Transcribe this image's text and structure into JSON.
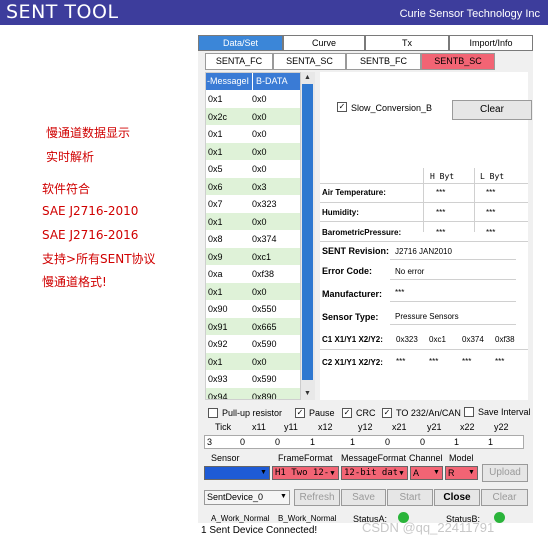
{
  "header": {
    "title": "SENT TOOL",
    "company": "Curie Sensor Technology Inc"
  },
  "notes": [
    "慢通道数据显示",
    "实时解析",
    "软件符合",
    "SAE J2716-2010",
    "SAE J2716-2016",
    "支持>所有SENT协议",
    "慢通道格式!"
  ],
  "tabs": [
    "Data/Set",
    "Curve",
    "Tx",
    "Import/Info"
  ],
  "subtabs": [
    "SENTA_FC",
    "SENTA_SC",
    "SENTB_FC",
    "SENTB_SC"
  ],
  "list": {
    "headers": [
      "-MessageI",
      "B-DATA"
    ],
    "rows": [
      [
        "0x1",
        "0x0"
      ],
      [
        "0x2c",
        "0x0"
      ],
      [
        "0x1",
        "0x0"
      ],
      [
        "0x1",
        "0x0"
      ],
      [
        "0x5",
        "0x0"
      ],
      [
        "0x6",
        "0x3"
      ],
      [
        "0x7",
        "0x323"
      ],
      [
        "0x1",
        "0x0"
      ],
      [
        "0x8",
        "0x374"
      ],
      [
        "0x9",
        "0xc1"
      ],
      [
        "0xa",
        "0xf38"
      ],
      [
        "0x1",
        "0x0"
      ],
      [
        "0x90",
        "0x550"
      ],
      [
        "0x91",
        "0x665"
      ],
      [
        "0x92",
        "0x590"
      ],
      [
        "0x1",
        "0x0"
      ],
      [
        "0x93",
        "0x590"
      ],
      [
        "0x94",
        "0x890"
      ]
    ]
  },
  "slow": {
    "checkbox_label": "Slow_Conversion_B",
    "checkbox_mark": "✓",
    "clear_label": "Clear",
    "col_hbyt": "H Byt",
    "col_lbyt": "L Byt",
    "measurements": [
      {
        "label": "Air Temperature:",
        "h": "***",
        "l": "***"
      },
      {
        "label": "Humidity:",
        "h": "***",
        "l": "***"
      },
      {
        "label": "BarometricPressure:",
        "h": "***",
        "l": "***"
      }
    ],
    "sent_revision_label": "SENT Revision:",
    "sent_revision_value": "J2716 JAN2010",
    "error_code_label": "Error Code:",
    "error_code_value": "No error",
    "manufacturer_label": "Manufacturer:",
    "manufacturer_value": "***",
    "sensor_type_label": "Sensor Type:",
    "sensor_type_value": "Pressure Sensors",
    "c1_label": "C1 X1/Y1 X2/Y2:",
    "c1_values": [
      "0x323",
      "0xc1",
      "0x374",
      "0xf38"
    ],
    "c2_label": "C2 X1/Y1 X2/Y2:",
    "c2_values": [
      "***",
      "***",
      "***",
      "***"
    ]
  },
  "options": {
    "pullup": "Pull-up resistor",
    "pause": "Pause",
    "crc": "CRC",
    "to232": "TO 232/An/CAN",
    "save_interval": "Save Interval",
    "check": "✓"
  },
  "ticks": {
    "headers": [
      "Tick",
      "x11",
      "y11",
      "x12",
      "y12",
      "x21",
      "y21",
      "x22",
      "y22"
    ],
    "values": [
      "3",
      "0",
      "0",
      "1",
      "1",
      "0",
      "0",
      "1",
      "1"
    ]
  },
  "selectors": {
    "sensor_label": "Sensor",
    "frame_label": "FrameFormat",
    "message_label": "MessageFormat",
    "channel_label": "Channel",
    "model_label": "Model",
    "sensor_value": "",
    "frame_value": "H1 Two 12-",
    "message_value": "12-bit dat",
    "channel_value": "A",
    "model_value": "R",
    "upload_label": "Upload",
    "arrow": "▼"
  },
  "device": {
    "selected": "SentDevice_0",
    "refresh": "Refresh",
    "save": "Save",
    "start": "Start",
    "close": "Close",
    "clear": "Clear"
  },
  "status": {
    "a_mode": "A_Work_Normal",
    "b_mode": "B_Work_Normal",
    "status_a": "StatusA:",
    "status_b": "StatusB:",
    "message": "1 Sent Device Connected!"
  },
  "watermark": "CSDN @qq_22411791",
  "colors": {
    "header_bg": "#3d3d9c",
    "note_red": "#d00000",
    "tab_active": "#3b86d8",
    "subtab_active": "#f26474",
    "row_green": "#dff2d8",
    "select_blue": "#1e5bd6",
    "select_red": "#f26474",
    "status_green": "#2ab43a"
  }
}
